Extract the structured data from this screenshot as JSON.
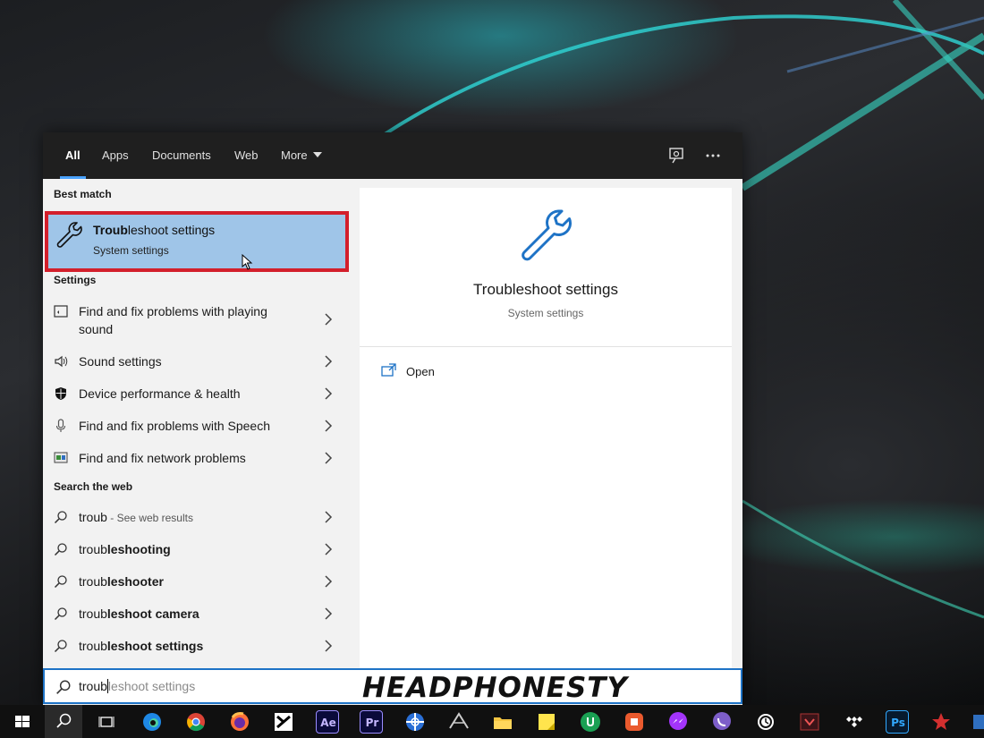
{
  "tabs": {
    "items": [
      "All",
      "Apps",
      "Documents",
      "Web",
      "More"
    ],
    "active": "All"
  },
  "left": {
    "best_match_heading": "Best match",
    "best_match": {
      "title_bold": "Troub",
      "title_rest": "leshoot settings",
      "subtitle": "System settings"
    },
    "settings_heading": "Settings",
    "settings": [
      {
        "icon": "troubleshoot-sound-icon",
        "label_line1": "Find and fix problems with playing",
        "label_line2": "sound"
      },
      {
        "icon": "speaker-icon",
        "label": "Sound settings"
      },
      {
        "icon": "shield-icon",
        "label": "Device performance & health"
      },
      {
        "icon": "microphone-icon",
        "label": "Find and fix problems with Speech"
      },
      {
        "icon": "network-troubleshoot-icon",
        "label": "Find and fix network problems"
      }
    ],
    "web_heading": "Search the web",
    "web": [
      {
        "prefix": "troub",
        "bold": "",
        "suffix": " - See web results"
      },
      {
        "prefix": "troub",
        "bold": "leshooting",
        "suffix": ""
      },
      {
        "prefix": "troub",
        "bold": "leshooter",
        "suffix": ""
      },
      {
        "prefix": "troub",
        "bold": "leshoot camera",
        "suffix": ""
      },
      {
        "prefix": "troub",
        "bold": "leshoot settings",
        "suffix": ""
      }
    ]
  },
  "right": {
    "title": "Troubleshoot settings",
    "subtitle": "System settings",
    "open_label": "Open"
  },
  "search": {
    "typed": "troub",
    "suggestion": "leshoot settings"
  },
  "watermark": "HEADPHONESTY",
  "taskbar": {
    "apps": [
      {
        "name": "start-button",
        "glyph": ""
      },
      {
        "name": "search-icon",
        "glyph": ""
      },
      {
        "name": "task-view-icon",
        "glyph": ""
      },
      {
        "name": "edge-icon",
        "glyph": ""
      },
      {
        "name": "chrome-icon",
        "glyph": ""
      },
      {
        "name": "firefox-icon",
        "glyph": ""
      },
      {
        "name": "capcut-icon",
        "glyph": ""
      },
      {
        "name": "after-effects-icon",
        "glyph": "Ae"
      },
      {
        "name": "premiere-icon",
        "glyph": "Pr"
      },
      {
        "name": "network-app-icon",
        "glyph": ""
      },
      {
        "name": "air-app-icon",
        "glyph": ""
      },
      {
        "name": "file-explorer-icon",
        "glyph": ""
      },
      {
        "name": "sticky-notes-icon",
        "glyph": ""
      },
      {
        "name": "upwork-icon",
        "glyph": ""
      },
      {
        "name": "office-icon",
        "glyph": ""
      },
      {
        "name": "messenger-icon",
        "glyph": ""
      },
      {
        "name": "viber-icon",
        "glyph": ""
      },
      {
        "name": "clock-app-icon",
        "glyph": ""
      },
      {
        "name": "app-icon",
        "glyph": ""
      },
      {
        "name": "tidal-icon",
        "glyph": ""
      },
      {
        "name": "photoshop-icon",
        "glyph": "Ps"
      },
      {
        "name": "app-red-icon",
        "glyph": ""
      }
    ]
  },
  "colors": {
    "accent": "#1e73c6",
    "highlight": "#9fc5e8",
    "annotation_red": "#d31f2b",
    "tabbar": "#1f1f1f"
  }
}
